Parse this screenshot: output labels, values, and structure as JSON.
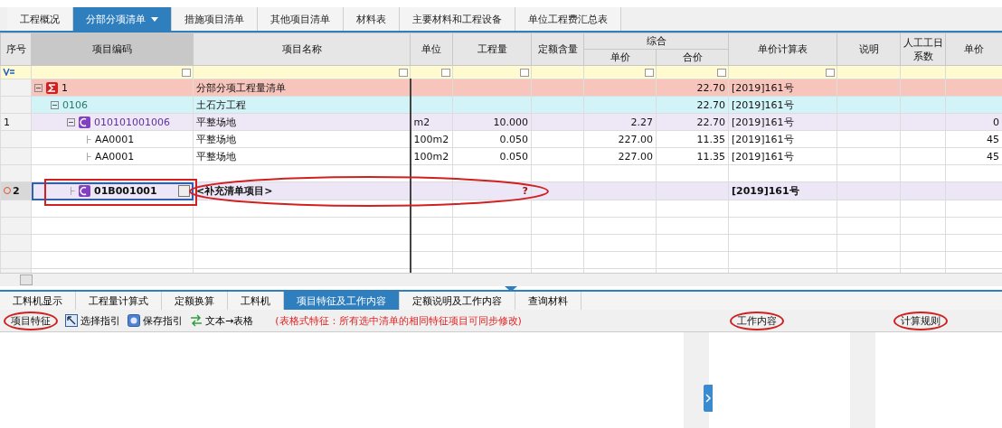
{
  "tabs": [
    {
      "label": "工程概况",
      "selected": false
    },
    {
      "label": "分部分项清单",
      "selected": true,
      "dropdown": true
    },
    {
      "label": "措施项目清单",
      "selected": false
    },
    {
      "label": "其他项目清单",
      "selected": false
    },
    {
      "label": "材料表",
      "selected": false
    },
    {
      "label": "主要材料和工程设备",
      "selected": false
    },
    {
      "label": "单位工程费汇总表",
      "selected": false
    }
  ],
  "columns": [
    {
      "label": "序号",
      "filter": false
    },
    {
      "label": "项目编码",
      "filter": true
    },
    {
      "label": "项目名称",
      "filter": true
    },
    {
      "label": "单位",
      "filter": true
    },
    {
      "label": "工程量",
      "filter": true
    },
    {
      "label": "定额含量",
      "filter": false
    },
    {
      "label": "综合",
      "children": [
        {
          "label": "单价",
          "filter": true
        },
        {
          "label": "合价",
          "filter": true
        }
      ]
    },
    {
      "label": "单价计算表",
      "filter": true
    },
    {
      "label": "说明",
      "filter": false
    },
    {
      "label": "人工工日系数",
      "filter": false
    },
    {
      "label": "单价",
      "filter": false
    }
  ],
  "rows": [
    {
      "kind": "total",
      "code": "1",
      "name": "分部分项工程量清单",
      "amount": "22.70",
      "calc_table": "[2019]161号",
      "expanded": true,
      "selected": false,
      "children": [
        {
          "kind": "section",
          "code": "0106",
          "name": "土石方工程",
          "amount": "22.70",
          "calc_table": "[2019]161号",
          "expanded": true,
          "selected": false,
          "children": [
            {
              "kind": "item",
              "seq": "1",
              "code": "010101001006",
              "name": "平整场地",
              "unit": "m2",
              "quantity": "10.000",
              "unit_price": "2.27",
              "amount": "22.70",
              "calc_table": "[2019]161号",
              "col_last": "0",
              "expanded": true,
              "selected": false,
              "children": [
                {
                  "kind": "quota",
                  "code": "AA0001",
                  "name": "平整场地",
                  "unit": "100m2",
                  "quantity": "0.050",
                  "unit_price": "227.00",
                  "amount": "11.35",
                  "calc_table": "[2019]161号",
                  "col_last": "45",
                  "selected": false
                },
                {
                  "kind": "quota",
                  "code": "AA0001",
                  "name": "平整场地",
                  "unit": "100m2",
                  "quantity": "0.050",
                  "unit_price": "227.00",
                  "amount": "11.35",
                  "calc_table": "[2019]161号",
                  "col_last": "45",
                  "selected": false
                }
              ]
            },
            {
              "kind": "blank"
            },
            {
              "kind": "new",
              "seq": "2",
              "code": "01B001001",
              "name": "<补充清单项目>",
              "quantity": "?",
              "calc_table": "[2019]161号",
              "selected": true,
              "circled": true
            }
          ]
        }
      ]
    }
  ],
  "bottom_tabs": [
    {
      "label": "工料机显示",
      "selected": false
    },
    {
      "label": "工程量计算式",
      "selected": false
    },
    {
      "label": "定额换算",
      "selected": false
    },
    {
      "label": "工料机",
      "selected": false
    },
    {
      "label": "项目特征及工作内容",
      "selected": true
    },
    {
      "label": "定额说明及工作内容",
      "selected": false
    },
    {
      "label": "查询材料",
      "selected": false
    }
  ],
  "toolbar": {
    "title": "项目特征",
    "title_circled": true,
    "buttons": [
      {
        "label": "选择指引"
      },
      {
        "label": "保存指引"
      },
      {
        "label": "文本→表格"
      }
    ],
    "hint": "(表格式特征：所有选中清单的相同特征项目可同步修改)"
  },
  "panes": [
    {
      "title": "工作内容",
      "circled": true
    },
    {
      "title": "计算规则",
      "circled": true
    }
  ]
}
